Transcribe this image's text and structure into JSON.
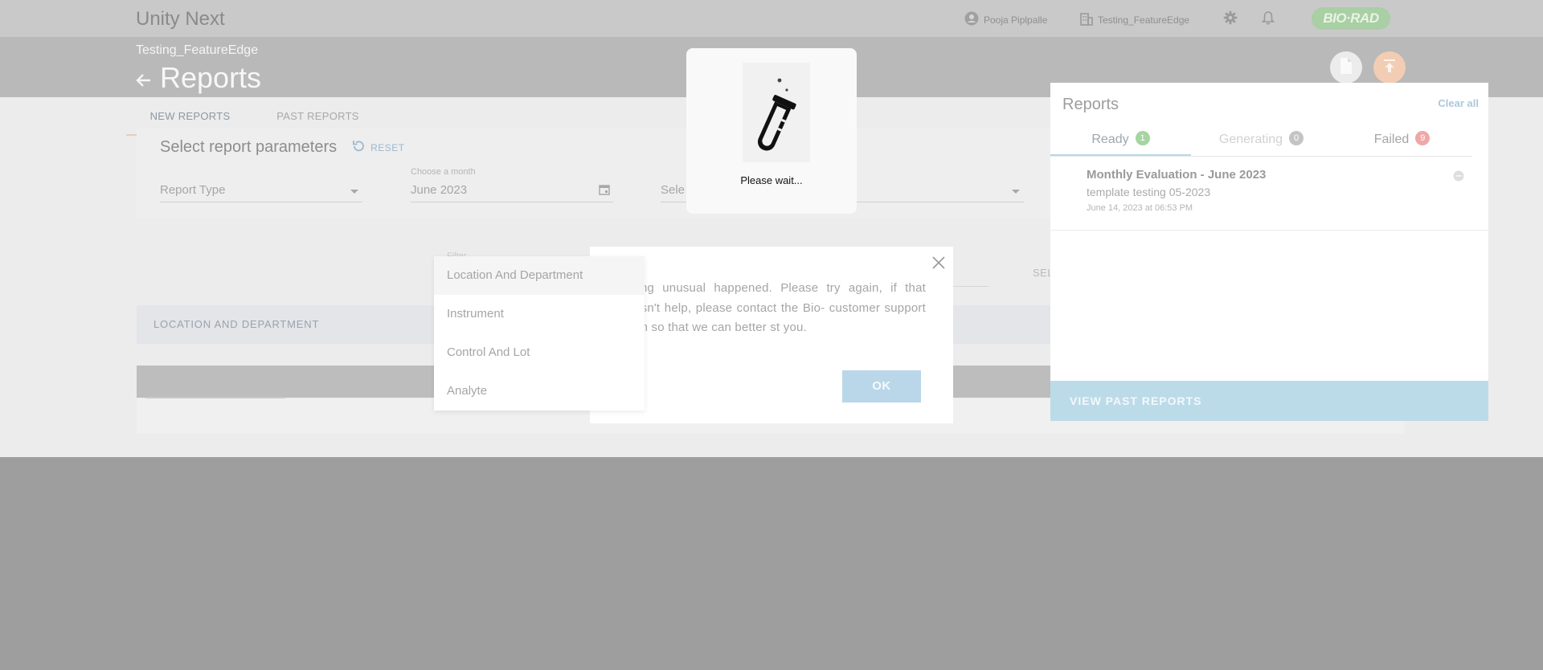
{
  "header": {
    "app_title": "Unity Next",
    "user_name": "Pooja Piplpalle",
    "lab_name": "Testing_FeatureEdge",
    "logo_text": "BIO·RAD"
  },
  "subheader": {
    "lab_name": "Testing_FeatureEdge",
    "page_title": "Reports"
  },
  "tabs": [
    {
      "label": "NEW REPORTS",
      "active": true
    },
    {
      "label": "PAST REPORTS",
      "active": false
    }
  ],
  "params": {
    "title": "Select report parameters",
    "reset_label": "RESET",
    "report_type_placeholder": "Report Type",
    "month_label": "Choose a month",
    "month_value": "June 2023",
    "select_placeholder_partial": "Sele",
    "filter_label_partial": "Filter",
    "side_text_partial": "SEL"
  },
  "section": {
    "label": "LOCATION AND DEPARTMENT"
  },
  "dropdown": {
    "options": [
      "Location And Department",
      "Instrument",
      "Control And Lot",
      "Analyte"
    ]
  },
  "error_dialog": {
    "message": "ething unusual happened. Please try again, if that doesn't help, please contact the Bio- customer support team so that we can better st you.",
    "ok_label": "OK"
  },
  "reports_panel": {
    "title": "Reports",
    "clear_all": "Clear all",
    "tabs": [
      {
        "label": "Ready",
        "count": "1",
        "color": "#a6d5a1"
      },
      {
        "label": "Generating",
        "count": "0",
        "color": "#c4c4c4"
      },
      {
        "label": "Failed",
        "count": "9",
        "color": "#f0a7a7"
      }
    ],
    "entry": {
      "title": "Monthly Evaluation - June 2023",
      "subtitle": "template testing 05-2023",
      "timestamp": "June 14, 2023 at 06:53 PM"
    },
    "footer": "VIEW PAST REPORTS"
  },
  "wait": {
    "text": "Please wait..."
  },
  "colors": {
    "accent_blue": "#b9d7e8",
    "ready_green": "#a6d5a1",
    "failed_red": "#f0a7a7",
    "upload_orange": "#f2cdb3"
  }
}
